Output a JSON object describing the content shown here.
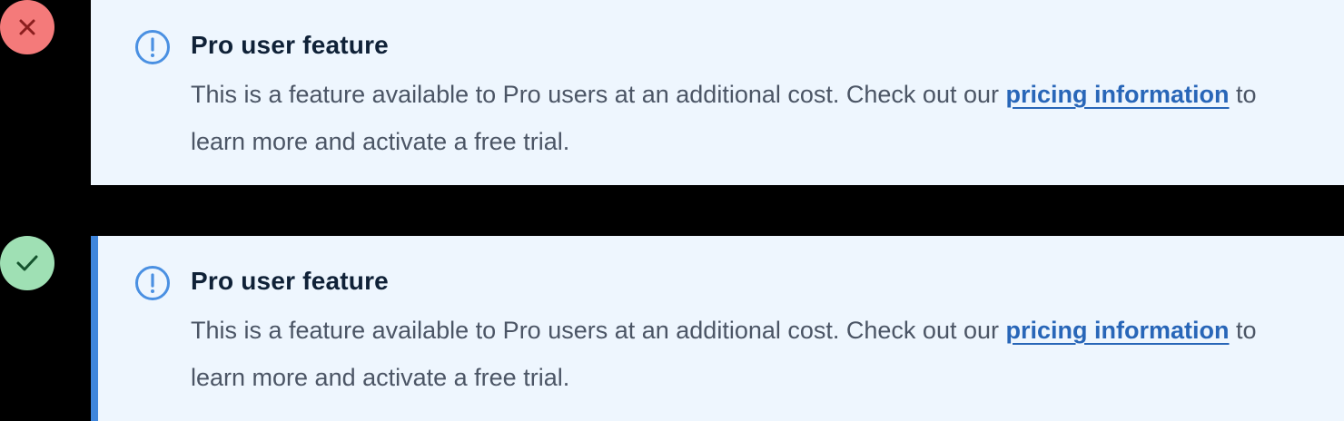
{
  "colors": {
    "background": "#000000",
    "callout_bg": "#eef6fe",
    "accent_border": "#3f86dc",
    "icon": "#4a90e2",
    "title": "#0f2137",
    "body_text": "#4b5565",
    "link": "#2866b8",
    "bad_badge": "#f47a7a",
    "good_badge": "#9fe0b4"
  },
  "examples": [
    {
      "verdict": "incorrect",
      "verdict_icon": "x-icon",
      "callout": {
        "icon": "info-circle-icon",
        "title": "Pro user feature",
        "body_before": "This is a feature available to Pro users at an additional cost. Check out our ",
        "link_text": "pricing information",
        "body_after": " to learn more and activate a free trial."
      }
    },
    {
      "verdict": "correct",
      "verdict_icon": "check-icon",
      "callout": {
        "icon": "info-circle-icon",
        "title": "Pro user feature",
        "body_before": "This is a feature available to Pro users at an additional cost. Check out our ",
        "link_text": "pricing information",
        "body_after": " to learn more and activate a free trial."
      }
    }
  ]
}
